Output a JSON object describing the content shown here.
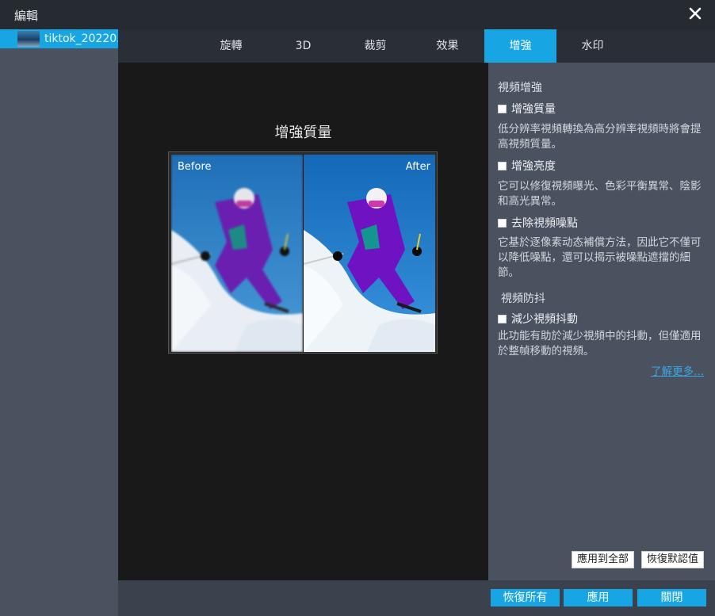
{
  "window": {
    "title": "編輯"
  },
  "sidebar": {
    "file_name": "tiktok_20220..."
  },
  "tabs": [
    {
      "label": "旋轉"
    },
    {
      "label": "3D"
    },
    {
      "label": "裁剪"
    },
    {
      "label": "效果"
    },
    {
      "label": "增強"
    },
    {
      "label": "水印"
    }
  ],
  "active_tab": "增強",
  "preview": {
    "title": "增強質量",
    "before_label": "Before",
    "after_label": "After"
  },
  "settings": {
    "video_enhance_heading": "視頻增強",
    "options": [
      {
        "label": "增強質量",
        "checked": false,
        "description": "低分辨率視頻轉換為高分辨率視頻時將會提高視頻質量。"
      },
      {
        "label": "增強亮度",
        "checked": false,
        "description": "它可以修復視頻曝光、色彩平衡異常、陰影和高光異常。"
      },
      {
        "label": "去除視頻噪點",
        "checked": false,
        "description": "它基於逐像素动态補償方法，因此它不僅可以降低噪點，還可以揭示被噪點遮擋的細節。"
      }
    ],
    "stabilize_heading": "視頻防抖",
    "stabilize_option": {
      "label": "減少視頻抖動",
      "checked": false,
      "description": "此功能有助於減少視頻中的抖動，但僅適用於整幀移動的視頻。"
    },
    "learn_more": "了解更多...",
    "apply_all_label": "應用到全部",
    "reset_default_label": "恢復默認值"
  },
  "footer": {
    "restore_all_label": "恢復所有",
    "apply_label": "應用",
    "close_label": "關閉"
  },
  "colors": {
    "accent": "#17a6e3",
    "panel": "#4a5260",
    "preview_bg": "#191919"
  }
}
